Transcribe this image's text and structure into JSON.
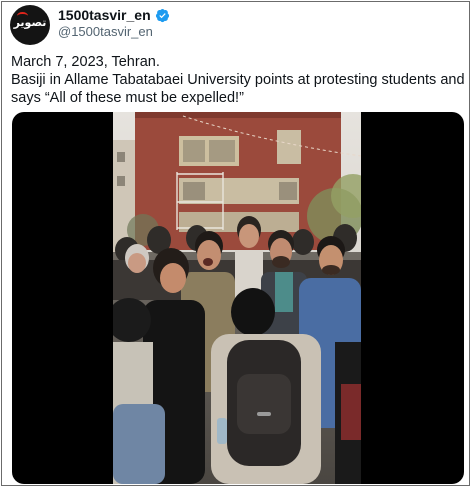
{
  "account": {
    "display_name": "1500tasvir_en",
    "handle": "@1500tasvir_en",
    "avatar_text": "تصویر",
    "verified": true,
    "verified_color": "#1d9bf0"
  },
  "tweet": {
    "line1": "March 7, 2023, Tehran.",
    "line2": "Basiji in Allame Tabatabaei University points at protesting students and",
    "line3": "says “All of these must be expelled!”"
  },
  "media": {
    "type": "video",
    "description_icon": "video-frame"
  }
}
